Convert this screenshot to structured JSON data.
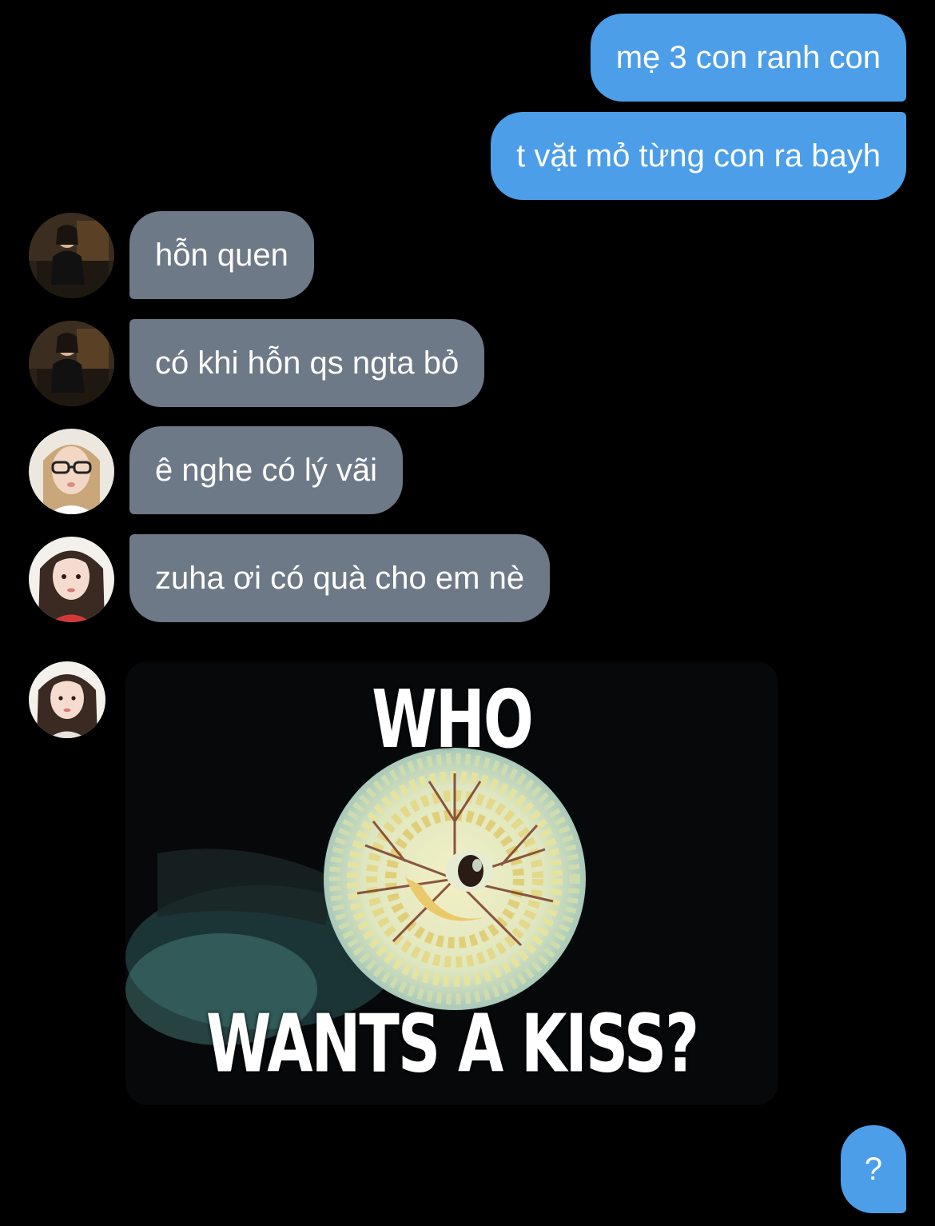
{
  "messages": {
    "out_1": "mẹ 3 con ranh con",
    "out_2": "t vặt mỏ từng con ra bayh",
    "in_1": "hỗn quen",
    "in_2": "có khi hỗn qs ngta bỏ",
    "in_3": "ê nghe có lý vãi",
    "in_4": "zuha ơi có quà cho em nè",
    "out_3": "?"
  },
  "meme": {
    "top_text": "WHO",
    "bottom_text": "WANTS A KISS?"
  },
  "colors": {
    "background": "#000000",
    "outgoing_bubble": "#4c9ee8",
    "incoming_bubble": "#6d7987"
  }
}
